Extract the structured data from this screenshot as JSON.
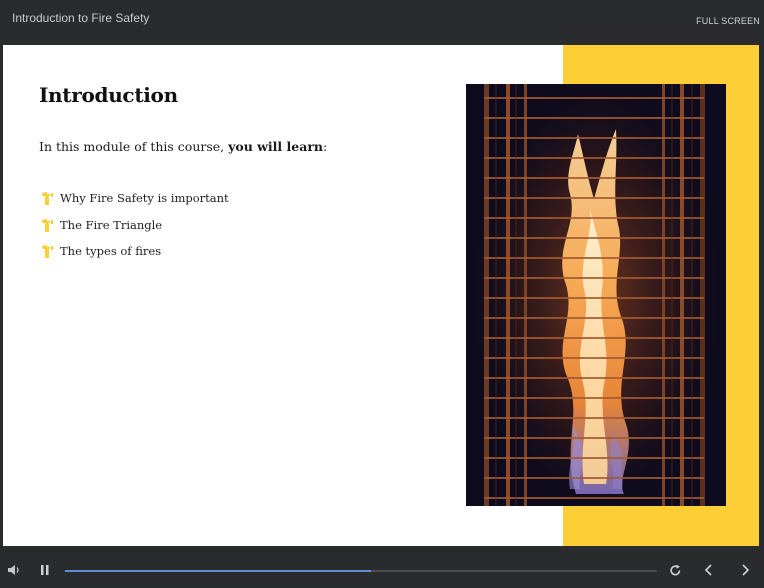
{
  "header": {
    "course_title": "Introduction to Fire Safety",
    "fullscreen_label": "FULL SCREEN"
  },
  "slide": {
    "heading": "Introduction",
    "intro_prefix": "In this module of this course, ",
    "intro_bold": "you will learn",
    "intro_suffix": ":",
    "bullets": [
      "Why Fire Safety is important",
      "The Fire Triangle",
      "The types of fires"
    ],
    "accent_color": "#fece36"
  },
  "player": {
    "progress": 0.517,
    "progress_color": "#5d8ed6",
    "icons": {
      "volume": "speaker-icon",
      "pause": "pause-icon",
      "replay": "replay-icon",
      "previous": "chevron-left-icon",
      "next": "chevron-right-icon"
    }
  }
}
